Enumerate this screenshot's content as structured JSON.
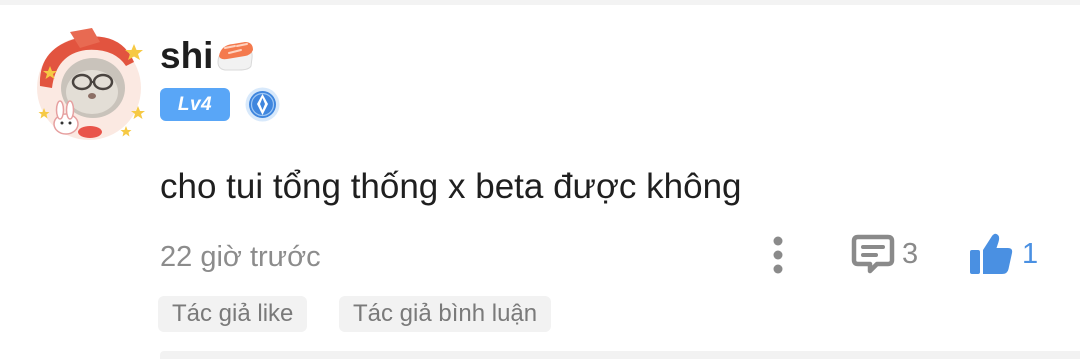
{
  "comment": {
    "username": "shi",
    "username_emoji": "sushi-icon",
    "level": "Lv4",
    "badge_icon": "medal-icon",
    "text": "cho tui tổng thống x beta được không",
    "timestamp": "22 giờ trước",
    "reply_count": "3",
    "like_count": "1",
    "liked": true,
    "tags": [
      "Tác giả like",
      "Tác giả bình luận"
    ]
  },
  "colors": {
    "level_badge": "#59a6f7",
    "like_active": "#4a90e2",
    "muted_text": "#8c8c8c",
    "tag_bg": "#f2f2f2"
  }
}
